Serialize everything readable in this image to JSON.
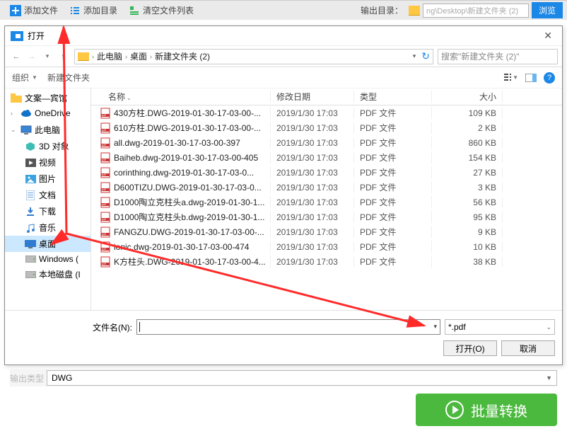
{
  "toolbar": {
    "add_file": "添加文件",
    "add_folder": "添加目录",
    "clear_list": "清空文件列表",
    "output_label": "输出目录：",
    "output_path": "ng\\Desktop\\新建文件夹 (2)",
    "browse": "浏览"
  },
  "dialog": {
    "title": "打开",
    "breadcrumb": [
      "此电脑",
      "桌面",
      "新建文件夹 (2)"
    ],
    "search_placeholder": "搜索\"新建文件夹 (2)\"",
    "organize": "组织",
    "new_folder": "新建文件夹",
    "columns": {
      "name": "名称",
      "date": "修改日期",
      "type": "类型",
      "size": "大小"
    },
    "file_name_label": "文件名(N):",
    "file_name_value": "",
    "filter": "*.pdf",
    "open_btn": "打开(O)",
    "cancel_btn": "取消"
  },
  "sidebar": [
    {
      "label": "文案—宾馆",
      "icon": "folder"
    },
    {
      "label": "OneDrive",
      "icon": "cloud"
    },
    {
      "label": "此电脑",
      "icon": "pc",
      "group": true
    },
    {
      "label": "3D 对象",
      "icon": "cube"
    },
    {
      "label": "视频",
      "icon": "video"
    },
    {
      "label": "图片",
      "icon": "image"
    },
    {
      "label": "文档",
      "icon": "doc"
    },
    {
      "label": "下载",
      "icon": "download"
    },
    {
      "label": "音乐",
      "icon": "music"
    },
    {
      "label": "桌面",
      "icon": "desktop",
      "selected": true
    },
    {
      "label": "Windows (",
      "icon": "disk"
    },
    {
      "label": "本地磁盘 (I",
      "icon": "disk"
    }
  ],
  "files": [
    {
      "name": "430方柱.DWG-2019-01-30-17-03-00-...",
      "date": "2019/1/30 17:03",
      "type": "PDF 文件",
      "size": "109 KB"
    },
    {
      "name": "610方柱.DWG-2019-01-30-17-03-00-...",
      "date": "2019/1/30 17:03",
      "type": "PDF 文件",
      "size": "2 KB"
    },
    {
      "name": "all.dwg-2019-01-30-17-03-00-397",
      "date": "2019/1/30 17:03",
      "type": "PDF 文件",
      "size": "860 KB"
    },
    {
      "name": "Baiheb.dwg-2019-01-30-17-03-00-405",
      "date": "2019/1/30 17:03",
      "type": "PDF 文件",
      "size": "154 KB"
    },
    {
      "name": "corinthing.dwg-2019-01-30-17-03-0...",
      "date": "2019/1/30 17:03",
      "type": "PDF 文件",
      "size": "27 KB"
    },
    {
      "name": "D600TIZU.DWG-2019-01-30-17-03-0...",
      "date": "2019/1/30 17:03",
      "type": "PDF 文件",
      "size": "3 KB"
    },
    {
      "name": "D1000陶立克柱头a.dwg-2019-01-30-1...",
      "date": "2019/1/30 17:03",
      "type": "PDF 文件",
      "size": "56 KB"
    },
    {
      "name": "D1000陶立克柱头b.dwg-2019-01-30-1...",
      "date": "2019/1/30 17:03",
      "type": "PDF 文件",
      "size": "95 KB"
    },
    {
      "name": "FANGZU.DWG-2019-01-30-17-03-00-...",
      "date": "2019/1/30 17:03",
      "type": "PDF 文件",
      "size": "9 KB"
    },
    {
      "name": "ionic.dwg-2019-01-30-17-03-00-474",
      "date": "2019/1/30 17:03",
      "type": "PDF 文件",
      "size": "10 KB"
    },
    {
      "name": "K方柱头.DWG-2019-01-30-17-03-00-4...",
      "date": "2019/1/30 17:03",
      "type": "PDF 文件",
      "size": "38 KB"
    }
  ],
  "output_type": "DWG",
  "convert": "批量转换"
}
